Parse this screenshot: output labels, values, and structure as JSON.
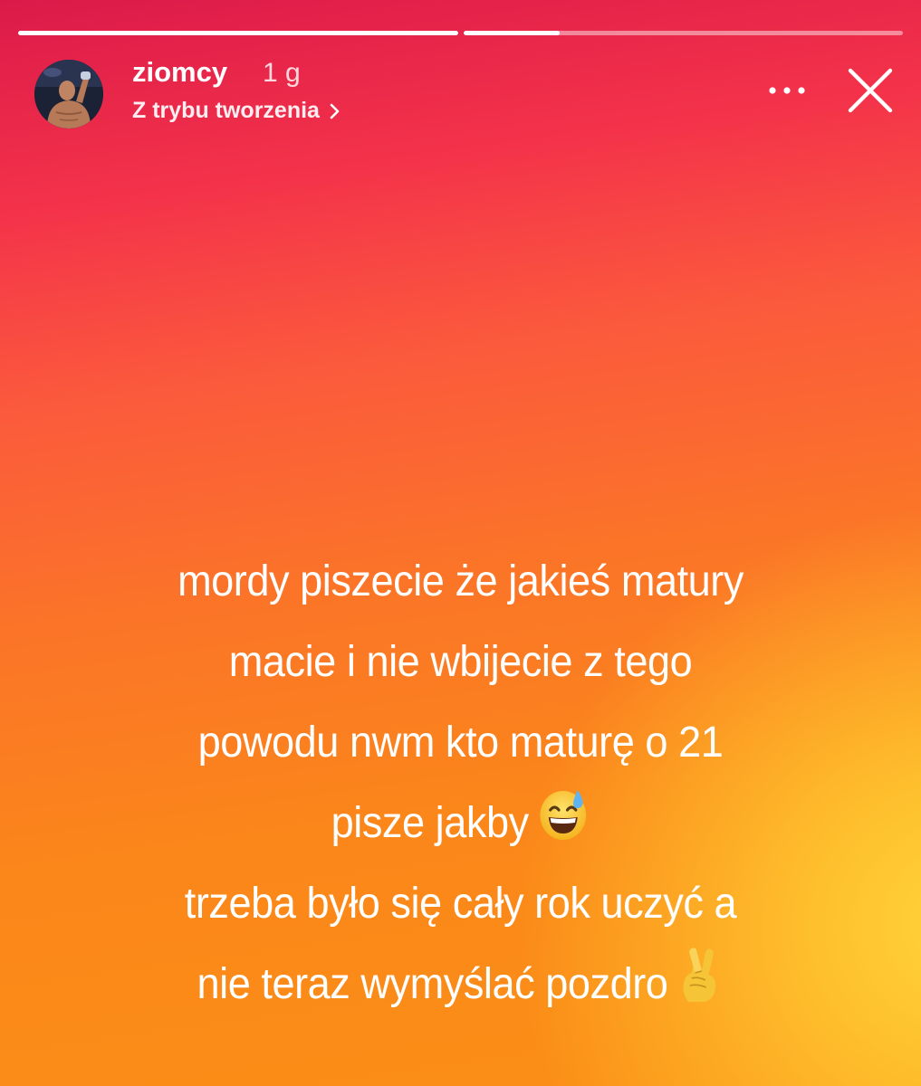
{
  "progress": {
    "segments": [
      {
        "fill": 1.0
      },
      {
        "fill": 0.22
      }
    ]
  },
  "header": {
    "username": "ziomcy",
    "time": "1 g",
    "subtitle": "Z trybu tworzenia"
  },
  "story": {
    "lines": [
      "mordy piszecie że jakieś matury",
      "macie i nie wbijecie z tego",
      "powodu nwm kto maturę o 21",
      "pisze jakby",
      "trzeba było się cały rok uczyć a",
      "nie teraz wymyślać pozdro"
    ]
  },
  "colors": {
    "gradient_top": "#dc1a4a",
    "gradient_mid": "#fb7428",
    "gradient_bottom": "#fb9016",
    "glow": "#ffd43a"
  },
  "icons": {
    "more": "more-horizontal-icon",
    "close": "close-icon",
    "chevron": "chevron-right-icon",
    "emoji_1": "grinning-sweat-emoji",
    "emoji_2": "crossed-fingers-emoji"
  }
}
